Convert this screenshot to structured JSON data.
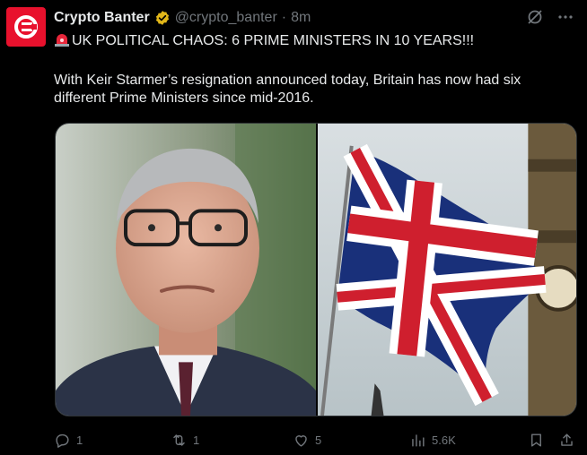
{
  "author": {
    "name": "Crypto Banter",
    "handle": "@crypto_banter",
    "separator": "·",
    "time": "8m",
    "avatar_icon": "crypto-banter-logo",
    "verified_color": "#e2b719",
    "brand_color": "#e8112d"
  },
  "post": {
    "headline": "UK POLITICAL CHAOS: 6 PRIME MINISTERS IN 10 YEARS!!!",
    "body": "With Keir Starmer’s resignation announced today, Britain has now had six different Prime Ministers since mid-2016."
  },
  "media": [
    {
      "icon": "portrait-photo"
    },
    {
      "icon": "union-jack-flag-photo"
    }
  ],
  "actions": {
    "reply_count": "1",
    "repost_count": "1",
    "like_count": "5",
    "view_count": "5.6K"
  },
  "colors": {
    "background": "#000000",
    "text": "#e7e9ea",
    "muted": "#71767b"
  }
}
